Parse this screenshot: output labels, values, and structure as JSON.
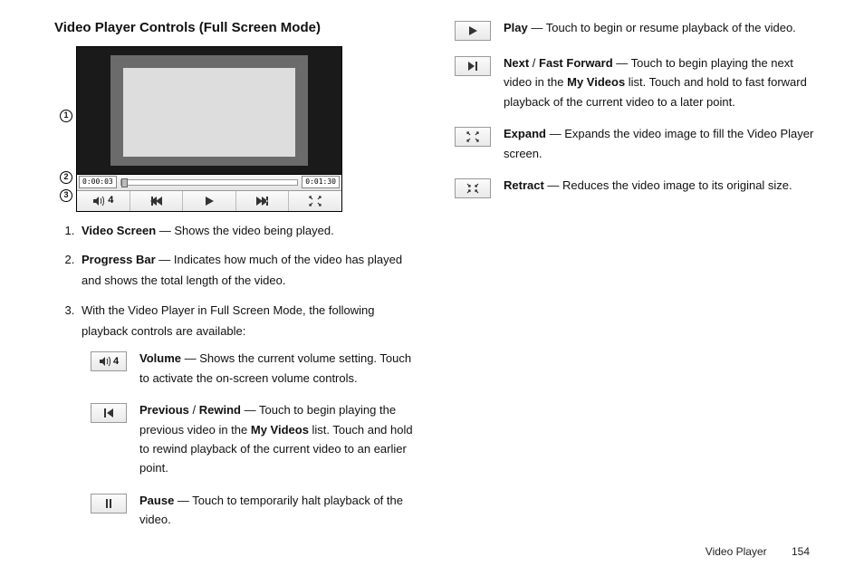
{
  "heading": "Video Player Controls (Full Screen Mode)",
  "mock": {
    "time_start": "0:00:03",
    "time_end": "0:01:30",
    "volume_value": "4",
    "callout_1": "1",
    "callout_2": "2",
    "callout_3": "3"
  },
  "list": {
    "i1_num": "1.",
    "i1_lead": "Video Screen",
    "i1_rest": " — Shows the video being played.",
    "i2_num": "2.",
    "i2_lead": "Progress Bar",
    "i2_rest": " — Indicates how much of the video has played and shows the total length of the video.",
    "i3_num": "3.",
    "i3_text": "With the Video Player in Full Screen Mode, the following playback controls are available:"
  },
  "ctrl": {
    "volume_lead": "Volume",
    "volume_rest": " — Shows the current volume setting. Touch to activate the on-screen volume controls.",
    "volume_value": "4",
    "prev_lead1": "Previous",
    "prev_sep": " / ",
    "prev_lead2": "Rewind",
    "prev_rest1": " — Touch to begin playing the previous video in the ",
    "prev_bold_list": "My Videos",
    "prev_rest2": " list. Touch and hold to rewind playback of the current video to an earlier point.",
    "pause_lead": "Pause",
    "pause_rest": " — Touch to temporarily halt playback of the video.",
    "play_lead": "Play",
    "play_rest": " — Touch to begin or resume playback of the video.",
    "next_lead1": "Next",
    "next_sep": " / ",
    "next_lead2": "Fast Forward",
    "next_rest1": " — Touch to begin playing the next video in the ",
    "next_bold_list": "My Videos",
    "next_rest2": " list. Touch and hold to fast forward playback of the current video to a later point.",
    "expand_lead": "Expand",
    "expand_rest": " — Expands the video image to fill the Video Player screen.",
    "retract_lead": "Retract",
    "retract_rest": " — Reduces the video image to its original size."
  },
  "footer": {
    "section": "Video Player",
    "page": "154"
  }
}
